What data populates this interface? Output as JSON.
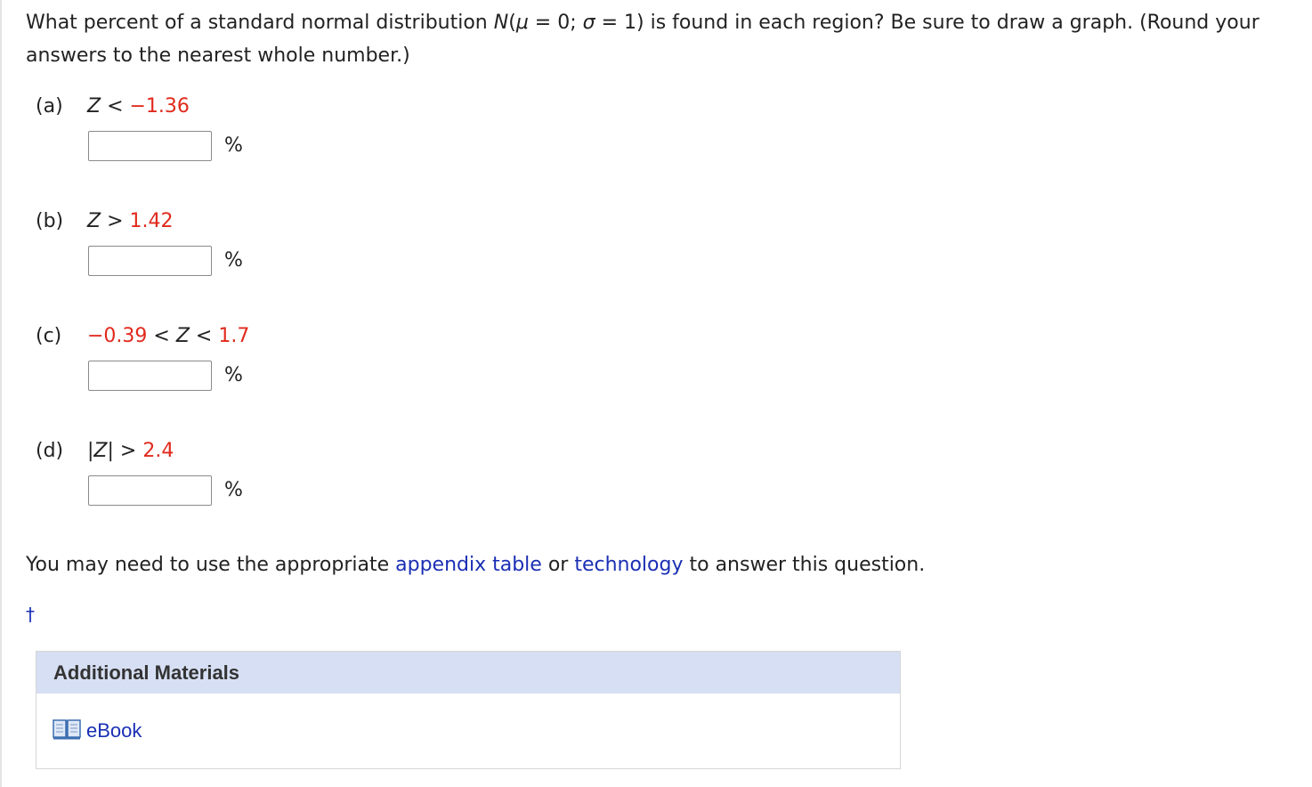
{
  "question": {
    "line_prefix": "What percent of a standard normal distribution ",
    "dist_symbol": "N",
    "dist_open": "(",
    "mu_symbol": "μ",
    "mu_eq": " = 0; ",
    "sigma_symbol": "σ",
    "sigma_eq": " = 1) is found in each region? Be sure to draw a graph. (Round your answers to the nearest whole number.)"
  },
  "parts": [
    {
      "tag": "(a)",
      "lhs": "",
      "var_pre": "Z",
      "op1": " < ",
      "val1": "−1.36",
      "mid": "",
      "val2": "",
      "unit": "%",
      "answer": ""
    },
    {
      "tag": "(b)",
      "lhs": "",
      "var_pre": "Z",
      "op1": " > ",
      "val1": "1.42",
      "mid": "",
      "val2": "",
      "unit": "%",
      "answer": ""
    },
    {
      "tag": "(c)",
      "lhs": "−0.39",
      "op0": " < ",
      "var_pre": "Z",
      "op1": " < ",
      "val1": "1.7",
      "unit": "%",
      "answer": ""
    },
    {
      "tag": "(d)",
      "abs_open": "|",
      "var_pre": "Z",
      "abs_close": "|",
      "op1": " > ",
      "val1": "2.4",
      "unit": "%",
      "answer": ""
    }
  ],
  "note": {
    "before": "You may need to use the appropriate ",
    "link1": "appendix table",
    "middle": " or ",
    "link2": "technology",
    "after": " to answer this question."
  },
  "dagger": "†",
  "materials": {
    "title": "Additional Materials",
    "ebook_label": "eBook",
    "ebook_icon": "book-icon"
  },
  "colors": {
    "highlight_red": "#e02a1d",
    "link_blue": "#1a2fb4",
    "header_bg": "#d6dff3"
  }
}
